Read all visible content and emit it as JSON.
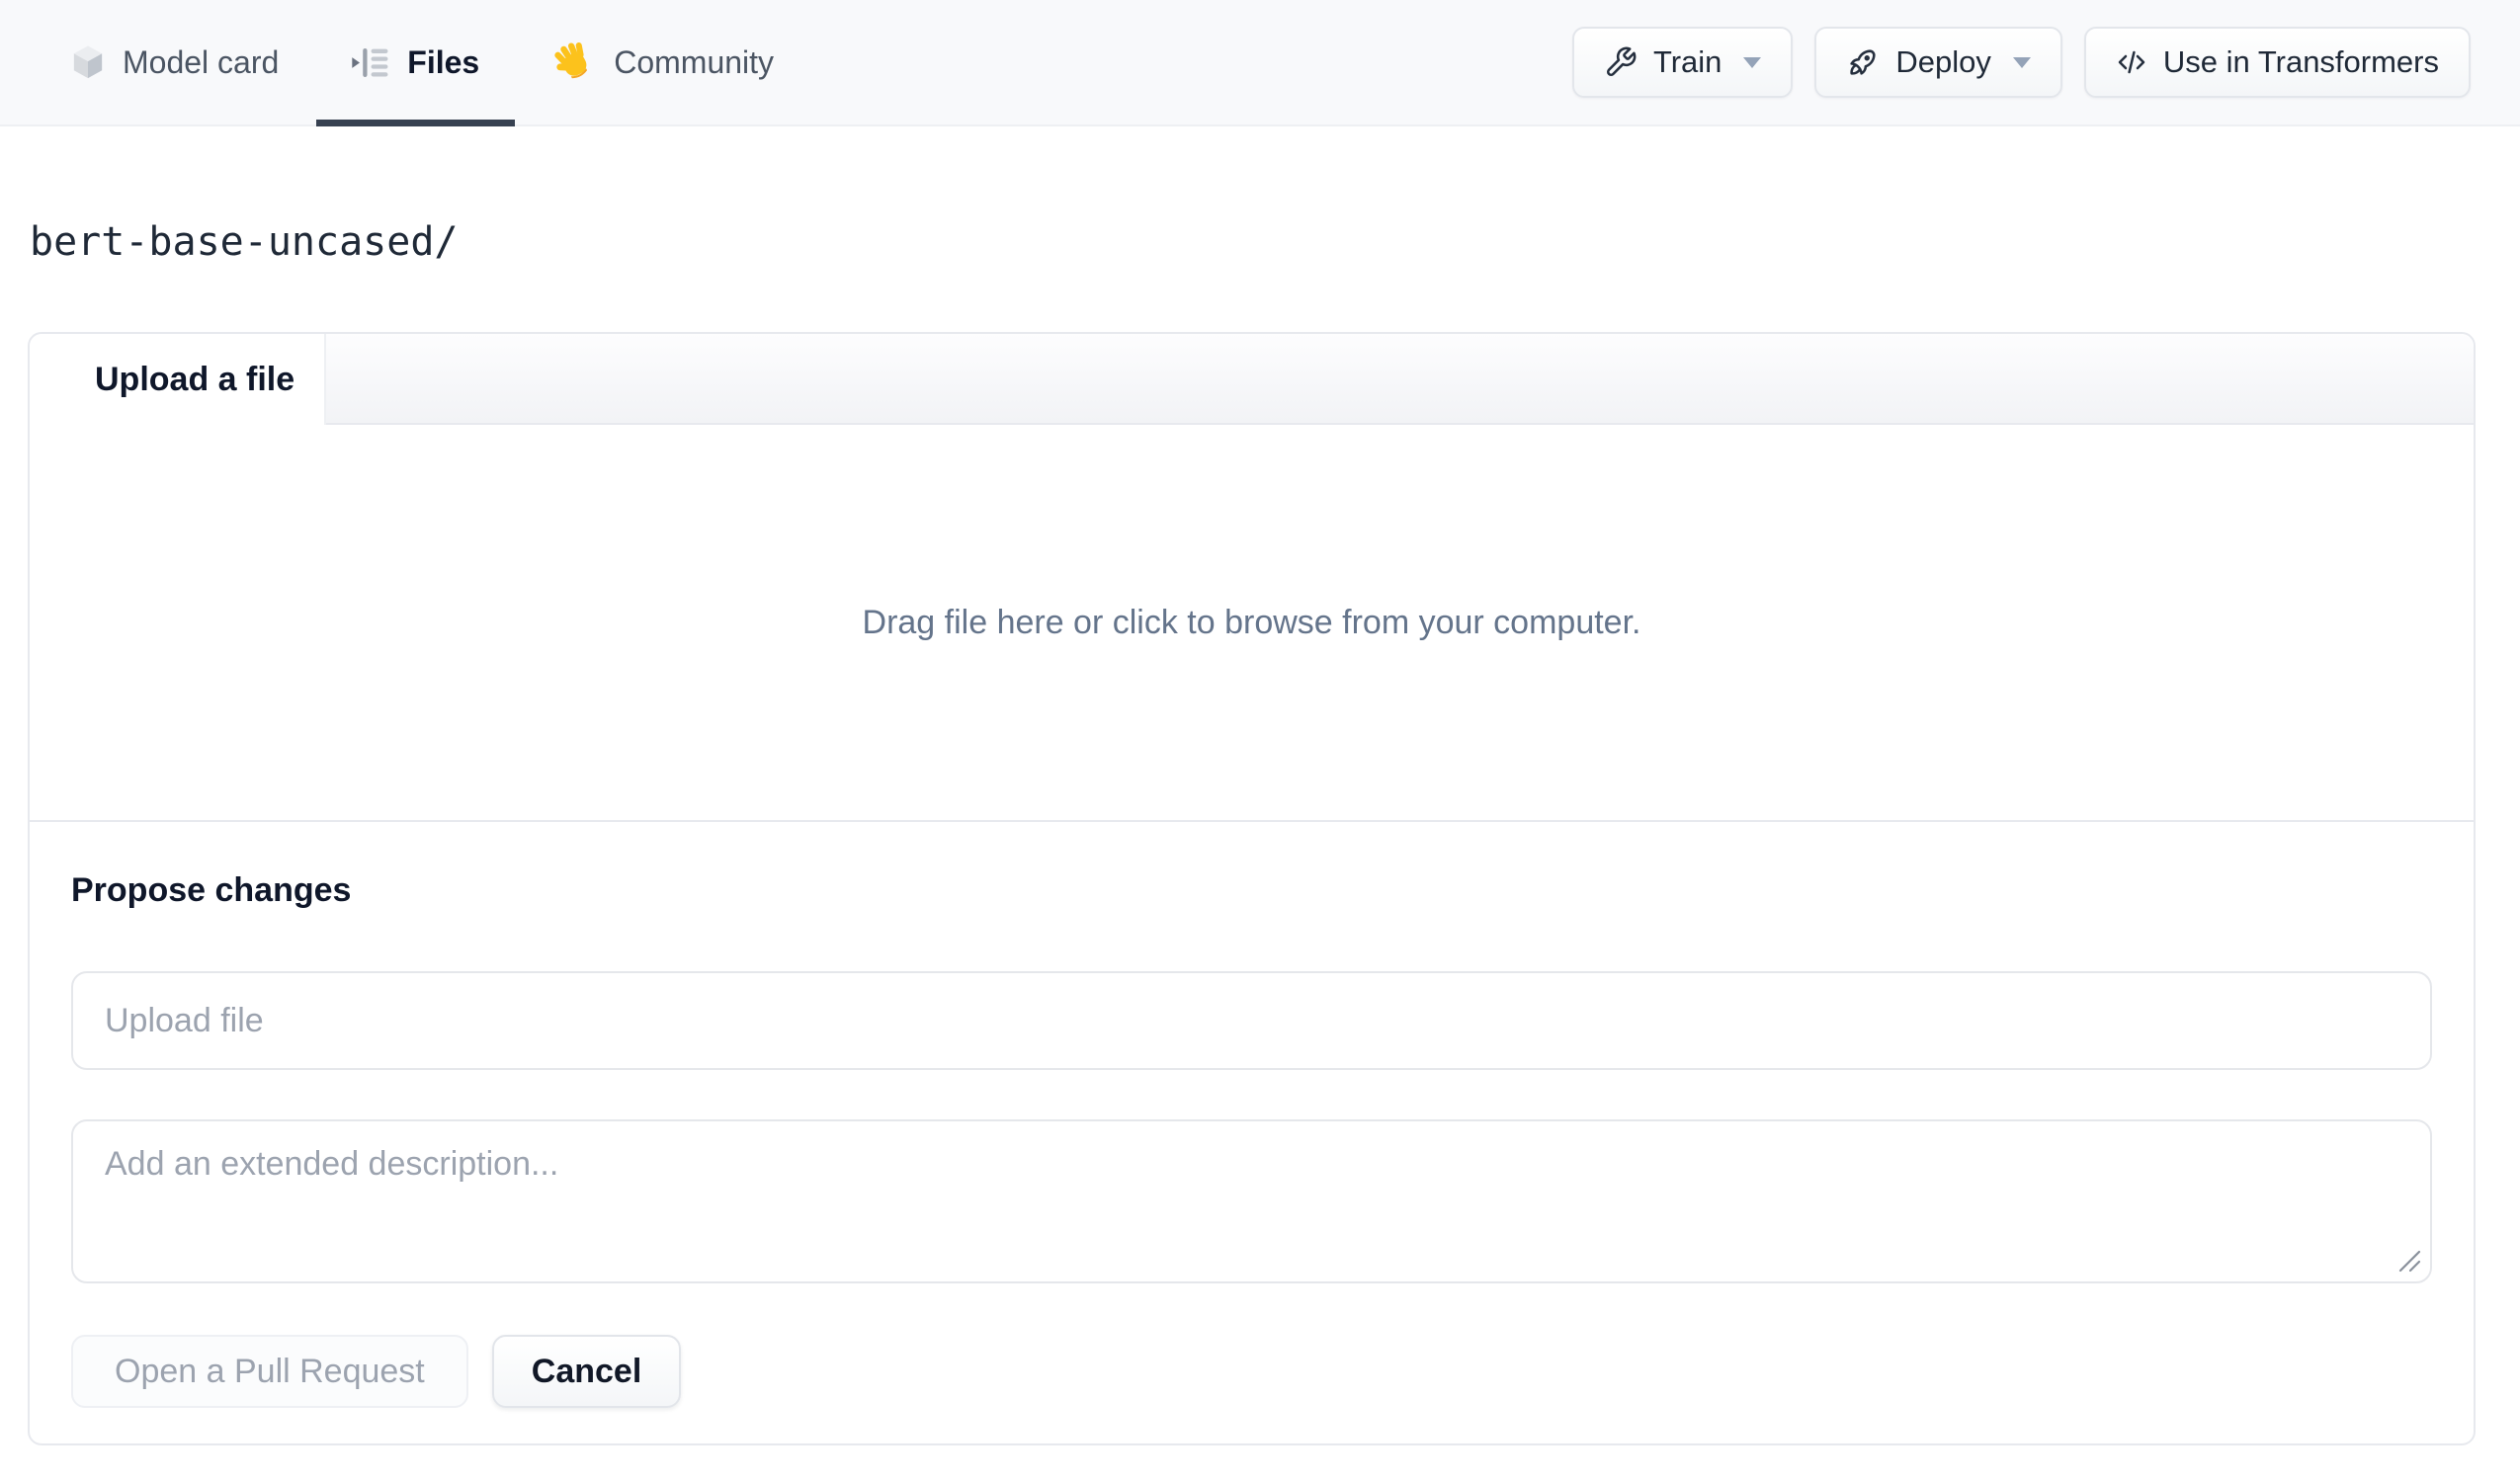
{
  "nav": {
    "tabs": [
      {
        "label": "Model card",
        "icon": "cube-icon",
        "active": false
      },
      {
        "label": "Files",
        "icon": "files-tree-icon",
        "active": true
      },
      {
        "label": "Community",
        "icon": "waving-hand-icon",
        "active": false
      }
    ],
    "actions": [
      {
        "label": "Train",
        "icon": "wrench-icon",
        "has_dropdown": true
      },
      {
        "label": "Deploy",
        "icon": "rocket-icon",
        "has_dropdown": true
      },
      {
        "label": "Use in Transformers",
        "icon": "code-icon",
        "has_dropdown": false
      }
    ]
  },
  "breadcrumb": {
    "path": "bert-base-uncased/"
  },
  "upload_card": {
    "tab_label": "Upload a file",
    "dropzone_hint": "Drag file here or click to browse from your computer.",
    "propose": {
      "heading": "Propose changes",
      "file_input_placeholder": "Upload file",
      "description_placeholder": "Add an extended description...",
      "submit_label": "Open a Pull Request",
      "submit_disabled": true,
      "cancel_label": "Cancel"
    }
  },
  "colors": {
    "active_tab_underline": "#374151",
    "nav_background": "#f8f9fb",
    "card_border": "#e7e9ee",
    "muted_text": "#64748b",
    "placeholder_text": "#9ca3af",
    "hand_emoji_yellow": "#fcc21c"
  }
}
